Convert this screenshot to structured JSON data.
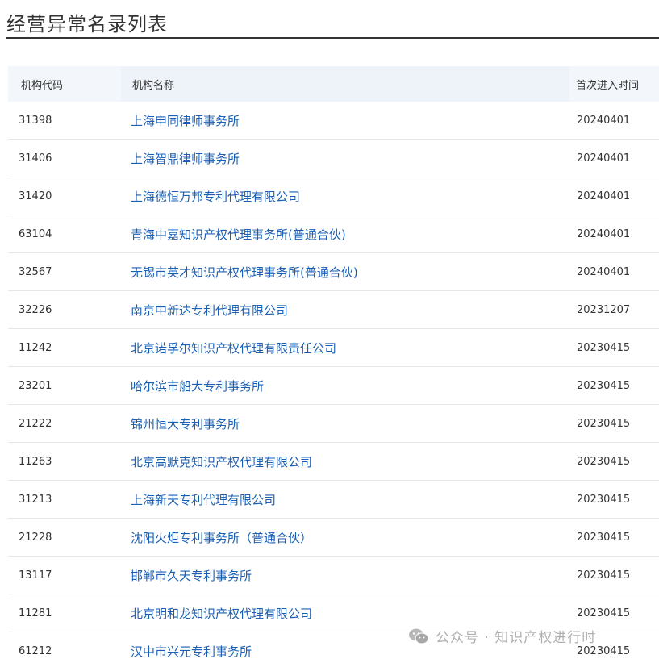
{
  "page": {
    "title": "经营异常名录列表"
  },
  "table": {
    "headers": {
      "code": "机构代码",
      "name": "机构名称",
      "date": "首次进入时间"
    },
    "rows": [
      {
        "code": "31398",
        "name": "上海申同律师事务所",
        "date": "20240401"
      },
      {
        "code": "31406",
        "name": "上海智鼎律师事务所",
        "date": "20240401"
      },
      {
        "code": "31420",
        "name": "上海德恒万邦专利代理有限公司",
        "date": "20240401"
      },
      {
        "code": "63104",
        "name": "青海中嘉知识产权代理事务所(普通合伙)",
        "date": "20240401"
      },
      {
        "code": "32567",
        "name": "无锡市英才知识产权代理事务所(普通合伙)",
        "date": "20240401"
      },
      {
        "code": "32226",
        "name": "南京中新达专利代理有限公司",
        "date": "20231207"
      },
      {
        "code": "11242",
        "name": "北京诺孚尔知识产权代理有限责任公司",
        "date": "20230415"
      },
      {
        "code": "23201",
        "name": "哈尔滨市船大专利事务所",
        "date": "20230415"
      },
      {
        "code": "21222",
        "name": "锦州恒大专利事务所",
        "date": "20230415"
      },
      {
        "code": "11263",
        "name": "北京高默克知识产权代理有限公司",
        "date": "20230415"
      },
      {
        "code": "31213",
        "name": "上海新天专利代理有限公司",
        "date": "20230415"
      },
      {
        "code": "21228",
        "name": "沈阳火炬专利事务所（普通合伙）",
        "date": "20230415"
      },
      {
        "code": "13117",
        "name": "邯郸市久天专利事务所",
        "date": "20230415"
      },
      {
        "code": "11281",
        "name": "北京明和龙知识产权代理有限公司",
        "date": "20230415"
      },
      {
        "code": "61212",
        "name": "汉中市兴元专利事务所",
        "date": "20230415"
      }
    ]
  },
  "watermark": {
    "text": "公众号 · 知识产权进行时",
    "icon": "wechat-icon"
  },
  "colors": {
    "link": "#1a5fb4",
    "header_bg": "#f3f7fb",
    "title_rule": "#333333"
  }
}
